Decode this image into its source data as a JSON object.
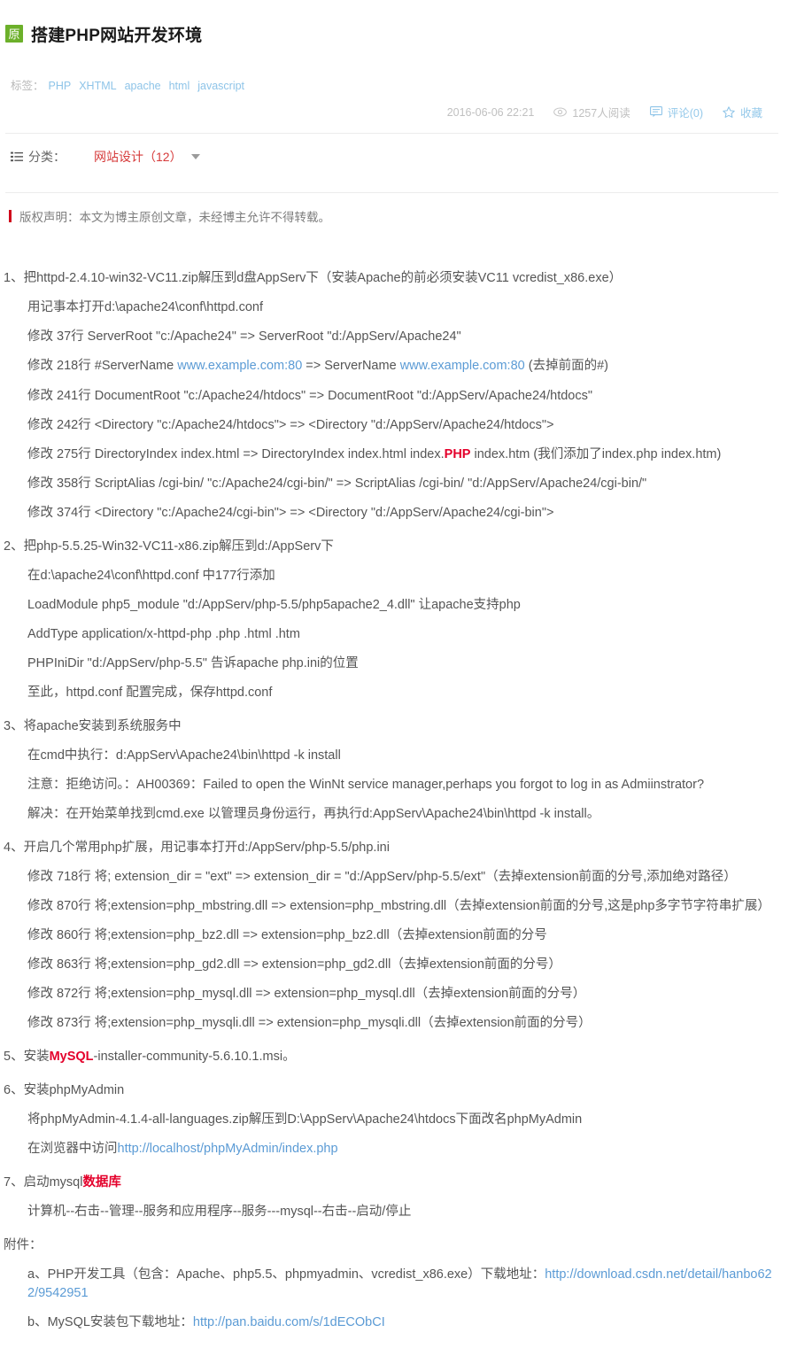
{
  "header": {
    "original_badge": "原",
    "title": "搭建PHP网站开发环境",
    "tags_label": "标签：",
    "tags": [
      "PHP",
      "XHTML",
      "apache",
      "html",
      "javascript"
    ],
    "date": "2016-06-06 22:21",
    "read_count": "1257人阅读",
    "comment": "评论(0)",
    "favorite": "收藏",
    "icons": {
      "eye": "eye-icon",
      "comment": "comment-icon",
      "star": "star-icon"
    }
  },
  "category": {
    "icon": "list-icon",
    "label": "分类：",
    "value": "网站设计（12）",
    "caret": "chevron-down-icon"
  },
  "copyright": {
    "text": "版权声明：本文为博主原创文章，未经博主允许不得转载。",
    "bar_color": "#d0021b"
  },
  "content": {
    "step1": {
      "title": "1、把httpd-2.4.10-win32-VC11.zip解压到d盘AppServ下（安装Apache的前必须安装VC11 vcredist_x86.exe）",
      "lines": [
        "用记事本打开d:\\apache24\\conf\\httpd.conf",
        "修改 37行 ServerRoot \"c:/Apache24\" => ServerRoot \"d:/AppServ/Apache24\"",
        "修改 241行 DocumentRoot \"c:/Apache24/htdocs\" => DocumentRoot \"d:/AppServ/Apache24/htdocs\"",
        "修改 242行 <Directory \"c:/Apache24/htdocs\"> => <Directory \"d:/AppServ/Apache24/htdocs\">",
        "修改 358行 ScriptAlias /cgi-bin/ \"c:/Apache24/cgi-bin/\" => ScriptAlias /cgi-bin/ \"d:/AppServ/Apache24/cgi-bin/\"",
        "修改 374行 <Directory \"c:/Apache24/cgi-bin\"> => <Directory \"d:/AppServ/Apache24/cgi-bin\">"
      ],
      "line218": {
        "prefix": "修改 218行 #ServerName ",
        "link1": "www.example.com:80",
        "middle": " => ServerName ",
        "link2": "www.example.com:80",
        "suffix": " (去掉前面的#)"
      },
      "line275": {
        "prefix": "修改 275行 DirectoryIndex index.html => DirectoryIndex index.html index.",
        "highlight": "PHP",
        "suffix": " index.htm (我们添加了index.php index.htm)"
      }
    },
    "step2": {
      "title": "2、把php-5.5.25-Win32-VC11-x86.zip解压到d:/AppServ下",
      "lines": [
        "在d:\\apache24\\conf\\httpd.conf 中177行添加",
        "LoadModule php5_module \"d:/AppServ/php-5.5/php5apache2_4.dll\" 让apache支持php",
        "AddType application/x-httpd-php .php .html .htm",
        "PHPIniDir \"d:/AppServ/php-5.5\"  告诉apache php.ini的位置",
        "至此，httpd.conf 配置完成，保存httpd.conf"
      ]
    },
    "step3": {
      "title": "3、将apache安装到系统服务中",
      "lines": [
        "在cmd中执行：d:AppServ\\Apache24\\bin\\httpd -k install",
        "注意：拒绝访问。：AH00369：Failed to open the WinNt service manager,perhaps you forgot to log in as Admiinstrator?",
        "解决：在开始菜单找到cmd.exe 以管理员身份运行，再执行d:AppServ\\Apache24\\bin\\httpd -k install。"
      ]
    },
    "step4": {
      "title": "4、开启几个常用php扩展，用记事本打开d:/AppServ/php-5.5/php.ini",
      "lines": [
        "修改 718行 将; extension_dir = \"ext\" => extension_dir = \"d:/AppServ/php-5.5/ext\"（去掉extension前面的分号,添加绝对路径）",
        "修改 870行 将;extension=php_mbstring.dll => extension=php_mbstring.dll（去掉extension前面的分号,这是php多字节字符串扩展）",
        "修改 860行 将;extension=php_bz2.dll => extension=php_bz2.dll（去掉extension前面的分号",
        "修改 863行 将;extension=php_gd2.dll => extension=php_gd2.dll（去掉extension前面的分号）",
        "修改 872行 将;extension=php_mysql.dll => extension=php_mysql.dll（去掉extension前面的分号）",
        "修改 873行 将;extension=php_mysqli.dll => extension=php_mysqli.dll（去掉extension前面的分号）"
      ]
    },
    "step5": {
      "prefix": "5、安装",
      "highlight": "MySQL",
      "suffix": "-installer-community-5.6.10.1.msi。"
    },
    "step6": {
      "title": "6、安装phpMyAdmin",
      "line1": "将phpMyAdmin-4.1.4-all-languages.zip解压到D:\\AppServ\\Apache24\\htdocs下面改名phpMyAdmin",
      "line2_prefix": "在浏览器中访问",
      "line2_link": "http://localhost/phpMyAdmin/index.php"
    },
    "step7": {
      "prefix": "7、启动mysql",
      "highlight": "数据库",
      "line1": "计算机--右击--管理--服务和应用程序--服务---mysql--右击--启动/停止"
    },
    "attachments": {
      "title": "附件：",
      "a_prefix": "a、PHP开发工具（包含：Apache、php5.5、phpmyadmin、vcredist_x86.exe）下载地址：",
      "a_link": "http://download.csdn.net/detail/hanbo622/9542951",
      "b_prefix": "b、MySQL安装包下载地址：",
      "b_link": "http://pan.baidu.com/s/1dECObCI"
    }
  }
}
